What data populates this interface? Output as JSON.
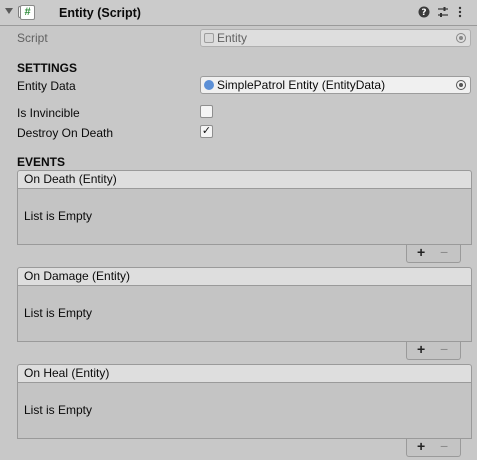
{
  "header": {
    "title": "Entity (Script)",
    "help_icon": "?",
    "settings_icon": "⇄",
    "menu_icon": "⋮",
    "script_icon_glyph": "#"
  },
  "fields": {
    "script_label": "Script",
    "script_value": "Entity",
    "settings_heading": "SETTINGS",
    "entity_data_label": "Entity Data",
    "entity_data_value": "SimplePatrol Entity (EntityData)",
    "is_invincible_label": "Is Invincible",
    "is_invincible_checked": false,
    "destroy_on_death_label": "Destroy On Death",
    "destroy_on_death_checked": true,
    "checkmark": "✓"
  },
  "events": {
    "heading": "EVENTS",
    "list": [
      {
        "title": "On Death (Entity)",
        "empty_text": "List is Empty",
        "add": "+",
        "remove": "−"
      },
      {
        "title": "On Damage (Entity)",
        "empty_text": "List is Empty",
        "add": "+",
        "remove": "−"
      },
      {
        "title": "On Heal (Entity)",
        "empty_text": "List is Empty",
        "add": "+",
        "remove": "−"
      }
    ]
  },
  "colors": {
    "background": "#c8c8c8",
    "script_icon": "#2e8b3a",
    "asset_icon": "#5b8fd6"
  }
}
